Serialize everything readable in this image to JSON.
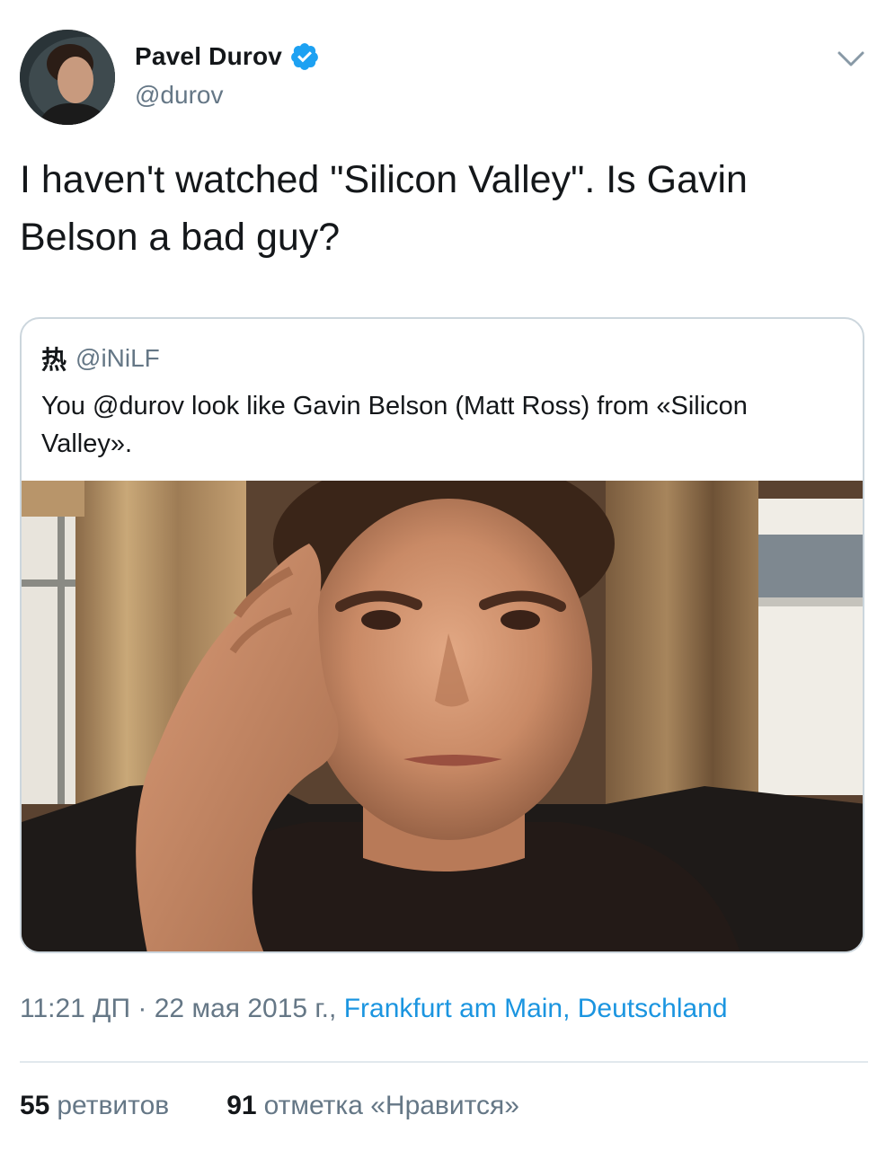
{
  "author": {
    "display_name": "Pavel Durov",
    "handle": "@durov",
    "verified_icon": "verified-badge-icon",
    "avatar_icon": "profile-avatar"
  },
  "tweet": {
    "text": "I haven't watched \"Silicon Valley\". Is Gavin Belson a bad guy?"
  },
  "quote": {
    "name": "热",
    "handle": "@iNiLF",
    "text": "You @durov look like Gavin Belson (Matt Ross) from «Silicon Valley».",
    "photo": "selfie-photo"
  },
  "meta": {
    "time": "11:21 ДП",
    "separator": " · ",
    "date": "22 мая 2015 г.,",
    "location": "Frankfurt am Main, Deutschland"
  },
  "stats": {
    "retweets_count": "55",
    "retweets_label": "ретвитов",
    "likes_count": "91",
    "likes_label": "отметка «Нравится»"
  },
  "colors": {
    "link": "#1b95e0",
    "secondary_text": "#657786",
    "verified": "#1da1f2",
    "border": "#ccd6dd"
  }
}
